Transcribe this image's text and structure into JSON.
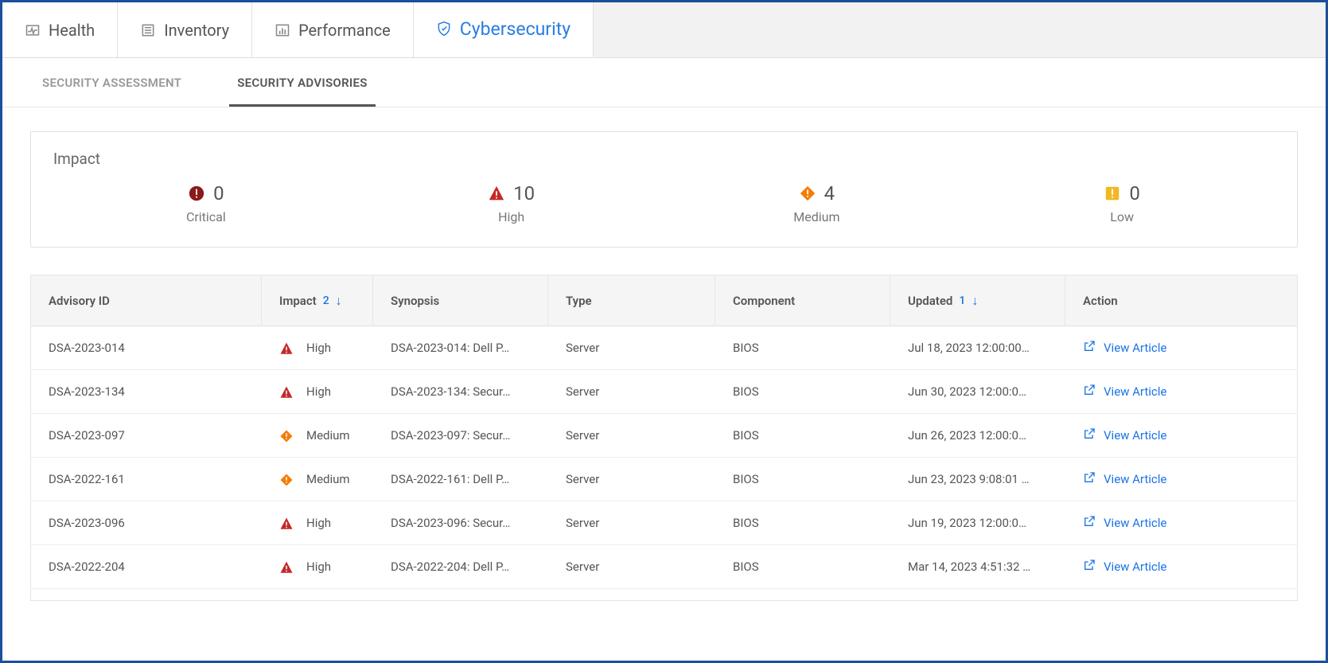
{
  "topTabs": {
    "health": "Health",
    "inventory": "Inventory",
    "performance": "Performance",
    "cybersecurity": "Cybersecurity"
  },
  "subTabs": {
    "assessment": "SECURITY ASSESSMENT",
    "advisories": "SECURITY ADVISORIES"
  },
  "impact": {
    "title": "Impact",
    "critical": {
      "label": "Critical",
      "value": "0"
    },
    "high": {
      "label": "High",
      "value": "10"
    },
    "medium": {
      "label": "Medium",
      "value": "4"
    },
    "low": {
      "label": "Low",
      "value": "0"
    }
  },
  "columns": {
    "advisoryId": "Advisory ID",
    "impact": "Impact",
    "impactSortOrder": "2",
    "synopsis": "Synopsis",
    "type": "Type",
    "component": "Component",
    "updated": "Updated",
    "updatedSortOrder": "1",
    "action": "Action"
  },
  "actionLabel": "View Article",
  "severityColors": {
    "critical": "#8b1a1a",
    "high": "#c62828",
    "medium": "#f57c00",
    "low": "#f2b824"
  },
  "rows": [
    {
      "id": "DSA-2023-014",
      "impact": "High",
      "synopsis": "DSA-2023-014: Dell P…",
      "type": "Server",
      "component": "BIOS",
      "updated": "Jul 18, 2023 12:00:00…"
    },
    {
      "id": "DSA-2023-134",
      "impact": "High",
      "synopsis": "DSA-2023-134: Secur…",
      "type": "Server",
      "component": "BIOS",
      "updated": "Jun 30, 2023 12:00:0…"
    },
    {
      "id": "DSA-2023-097",
      "impact": "Medium",
      "synopsis": "DSA-2023-097: Secur…",
      "type": "Server",
      "component": "BIOS",
      "updated": "Jun 26, 2023 12:00:0…"
    },
    {
      "id": "DSA-2022-161",
      "impact": "Medium",
      "synopsis": "DSA-2022-161: Dell P…",
      "type": "Server",
      "component": "BIOS",
      "updated": "Jun 23, 2023 9:08:01 …"
    },
    {
      "id": "DSA-2023-096",
      "impact": "High",
      "synopsis": "DSA-2023-096: Secur…",
      "type": "Server",
      "component": "BIOS",
      "updated": "Jun 19, 2023 12:00:0…"
    },
    {
      "id": "DSA-2022-204",
      "impact": "High",
      "synopsis": "DSA-2022-204: Dell P…",
      "type": "Server",
      "component": "BIOS",
      "updated": "Mar 14, 2023 4:51:32 …"
    }
  ]
}
